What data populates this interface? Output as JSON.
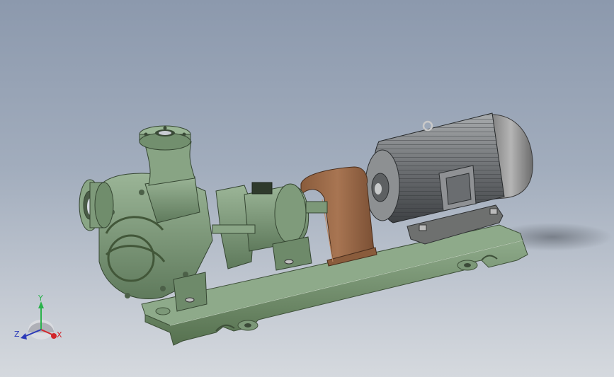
{
  "viewport": {
    "background_top": "#8c99ad",
    "background_bottom": "#d5d9de"
  },
  "model": {
    "body_color": "#7e9a7a",
    "body_shade": "#5d775a",
    "guard_color": "#9b6a48",
    "motor_color": "#8a8c8e",
    "motor_dark": "#3c3f42",
    "fan_cover_color": "#9c9c9c"
  },
  "triad": {
    "y_label": "Y",
    "x_label": "X",
    "z_label": "Z",
    "y_color": "#2bb24c",
    "x_color": "#d1262b",
    "z_color": "#2a39b8"
  }
}
